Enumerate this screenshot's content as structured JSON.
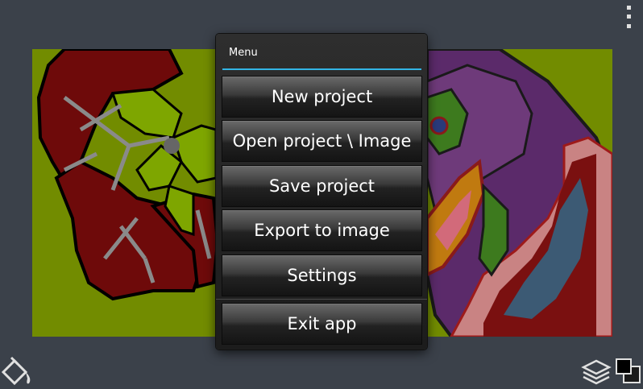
{
  "dialog": {
    "title": "Menu",
    "items": [
      {
        "label": "New project"
      },
      {
        "label": "Open project \\ Image"
      },
      {
        "label": "Save project"
      },
      {
        "label": "Export to image"
      },
      {
        "label": "Settings"
      },
      {
        "label": "Exit app"
      }
    ]
  },
  "toolbar": {
    "overflow_icon": "overflow-menu-icon",
    "fill_tool_icon": "paint-bucket-icon",
    "layers_icon": "layers-icon",
    "color_swap_icon": "color-swatch-icon"
  },
  "colors": {
    "background": "#3b414a",
    "canvas_bg": "#728c00",
    "accent": "#33b5e5"
  }
}
